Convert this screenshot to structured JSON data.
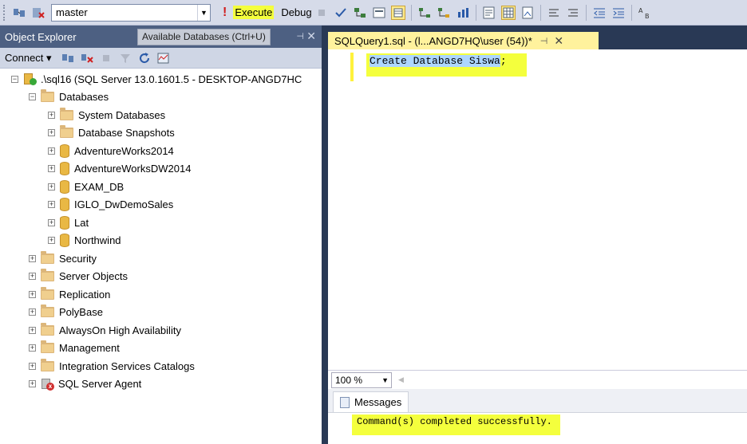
{
  "toolbar": {
    "database": "master",
    "execute_label": "Execute",
    "debug_label": "Debug"
  },
  "object_explorer": {
    "title": "Object Explorer",
    "tooltip": "Available Databases (Ctrl+U)",
    "connect_label": "Connect",
    "server": ".\\sql16 (SQL Server 13.0.1601.5 - DESKTOP-ANGD7HC",
    "databases_label": "Databases",
    "database_children": [
      "System Databases",
      "Database Snapshots",
      "AdventureWorks2014",
      "AdventureWorksDW2014",
      "EXAM_DB",
      "IGLO_DwDemoSales",
      "Lat",
      "Northwind"
    ],
    "server_children": [
      "Security",
      "Server Objects",
      "Replication",
      "PolyBase",
      "AlwaysOn High Availability",
      "Management",
      "Integration Services Catalogs"
    ],
    "agent_label": "SQL Server Agent"
  },
  "document": {
    "tab_title": "SQLQuery1.sql - (l...ANGD7HQ\\user (54))*",
    "code": "Create Database Siswa",
    "code_tail": ";",
    "zoom": "100 %"
  },
  "results": {
    "tab_label": "Messages",
    "message": "Command(s) completed successfully."
  },
  "colors": {
    "highlight": "#f4ff3d",
    "chrome": "#293955",
    "tab_active": "#fff29d"
  }
}
